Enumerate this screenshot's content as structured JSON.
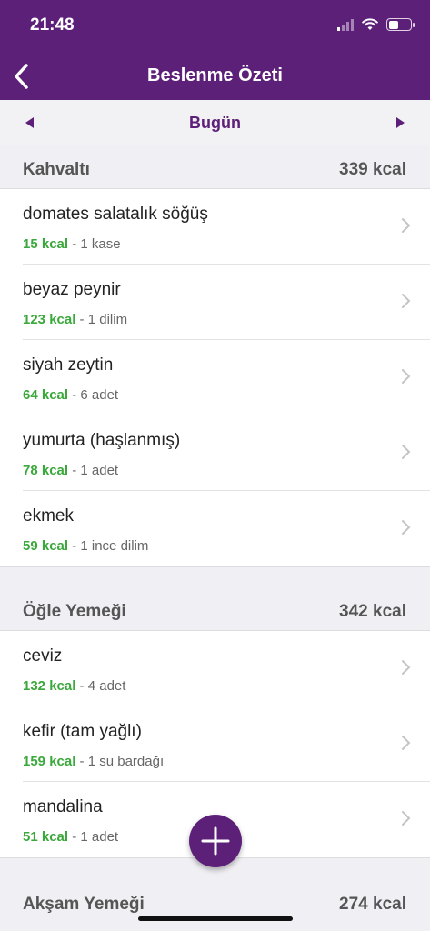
{
  "status_bar": {
    "time": "21:48"
  },
  "header": {
    "title": "Beslenme Özeti"
  },
  "date_nav": {
    "label": "Bugün"
  },
  "meals": [
    {
      "name": "Kahvaltı",
      "total": "339 kcal",
      "items": [
        {
          "name": "domates salatalık söğüş",
          "kcal": "15 kcal",
          "portion": " - 1 kase"
        },
        {
          "name": "beyaz peynir",
          "kcal": "123 kcal",
          "portion": " - 1 dilim"
        },
        {
          "name": "siyah zeytin",
          "kcal": "64 kcal",
          "portion": " - 6 adet"
        },
        {
          "name": "yumurta (haşlanmış)",
          "kcal": "78 kcal",
          "portion": " - 1 adet"
        },
        {
          "name": "ekmek",
          "kcal": "59 kcal",
          "portion": " - 1 ince dilim"
        }
      ]
    },
    {
      "name": "Öğle Yemeği",
      "total": "342 kcal",
      "items": [
        {
          "name": "ceviz",
          "kcal": "132 kcal",
          "portion": " - 4 adet"
        },
        {
          "name": "kefir (tam yağlı)",
          "kcal": "159 kcal",
          "portion": " - 1 su bardağı"
        },
        {
          "name": "mandalina",
          "kcal": "51 kcal",
          "portion": " - 1 adet"
        }
      ]
    },
    {
      "name": "Akşam Yemeği",
      "total": "274 kcal",
      "items": []
    }
  ],
  "icons": {
    "back": "chevron-left-icon",
    "prev": "triangle-left-icon",
    "next": "triangle-right-icon",
    "row": "chevron-right-icon",
    "add": "plus-icon"
  },
  "colors": {
    "primary": "#5d2079",
    "kcal": "#3aa83a"
  }
}
